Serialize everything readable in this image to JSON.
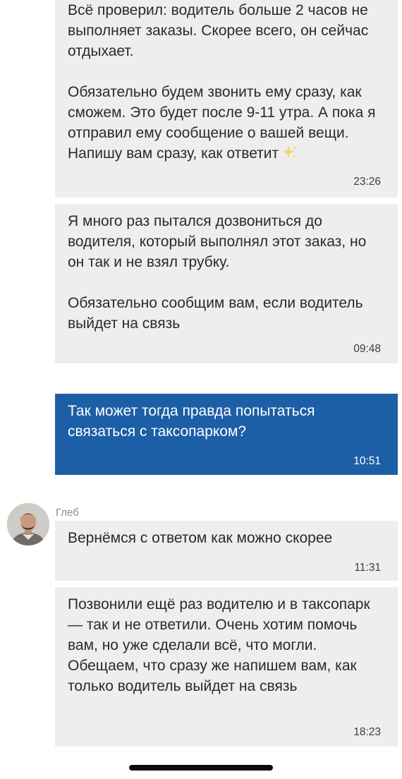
{
  "colors": {
    "incoming_bubble": "#efeeec",
    "outgoing_bubble": "#1c5fa6",
    "sparkle": "#f4d26b"
  },
  "messages": [
    {
      "direction": "incoming",
      "text": "Всё проверил: водитель больше 2 часов не выполняет заказы. Скорее всего, он сейчас отдыхает.\n\nОбязательно будем звонить ему сразу, как сможем. Это будет после 9-11 утра. А пока я отправил ему сообщение о вашей вещи. Напишу вам сразу, как ответит",
      "emoji_icon": "sparkles-icon",
      "time": "23:26"
    },
    {
      "direction": "incoming",
      "text": "Я много раз пытался дозвониться до водителя, который выполнял этот заказ, но он так и не взял трубку.\n\nОбязательно сообщим вам, если водитель выйдет на связь",
      "time": "09:48"
    },
    {
      "direction": "outgoing",
      "text": "Так может тогда правда попытаться связаться с таксопарком?",
      "time": "10:51"
    },
    {
      "direction": "incoming",
      "sender": "Глеб",
      "avatar_icon": "avatar",
      "text": "Вернёмся с ответом как можно скорее",
      "time": "11:31"
    },
    {
      "direction": "incoming",
      "text": "Позвонили ещё раз водителю и в таксопарк — так и не ответили. Очень хотим помочь вам, но уже сделали всё, что могли. Обещаем, что сразу же напишем вам, как только водитель выйдет на связь",
      "time": "18:23"
    }
  ]
}
